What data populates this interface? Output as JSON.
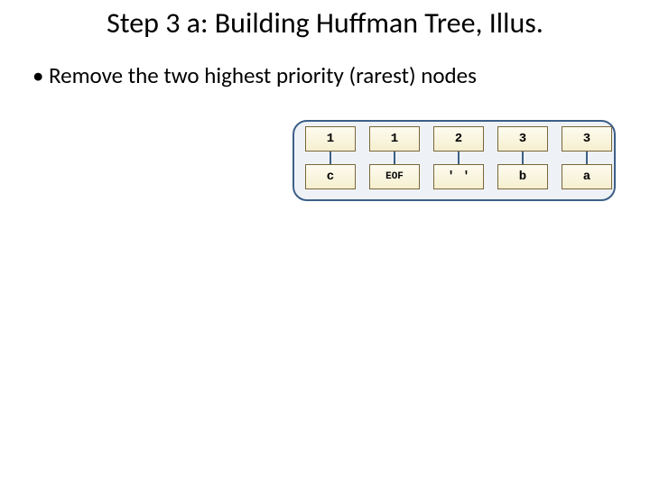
{
  "title": "Step 3 a: Building Huffman Tree, Illus.",
  "bullet": "Remove the two highest priority (rarest) nodes",
  "queue": {
    "nodes": [
      {
        "freq": "1",
        "sym": "c"
      },
      {
        "freq": "1",
        "sym": "EOF"
      },
      {
        "freq": "2",
        "sym": "' '"
      },
      {
        "freq": "3",
        "sym": "b"
      },
      {
        "freq": "3",
        "sym": "a"
      }
    ]
  }
}
